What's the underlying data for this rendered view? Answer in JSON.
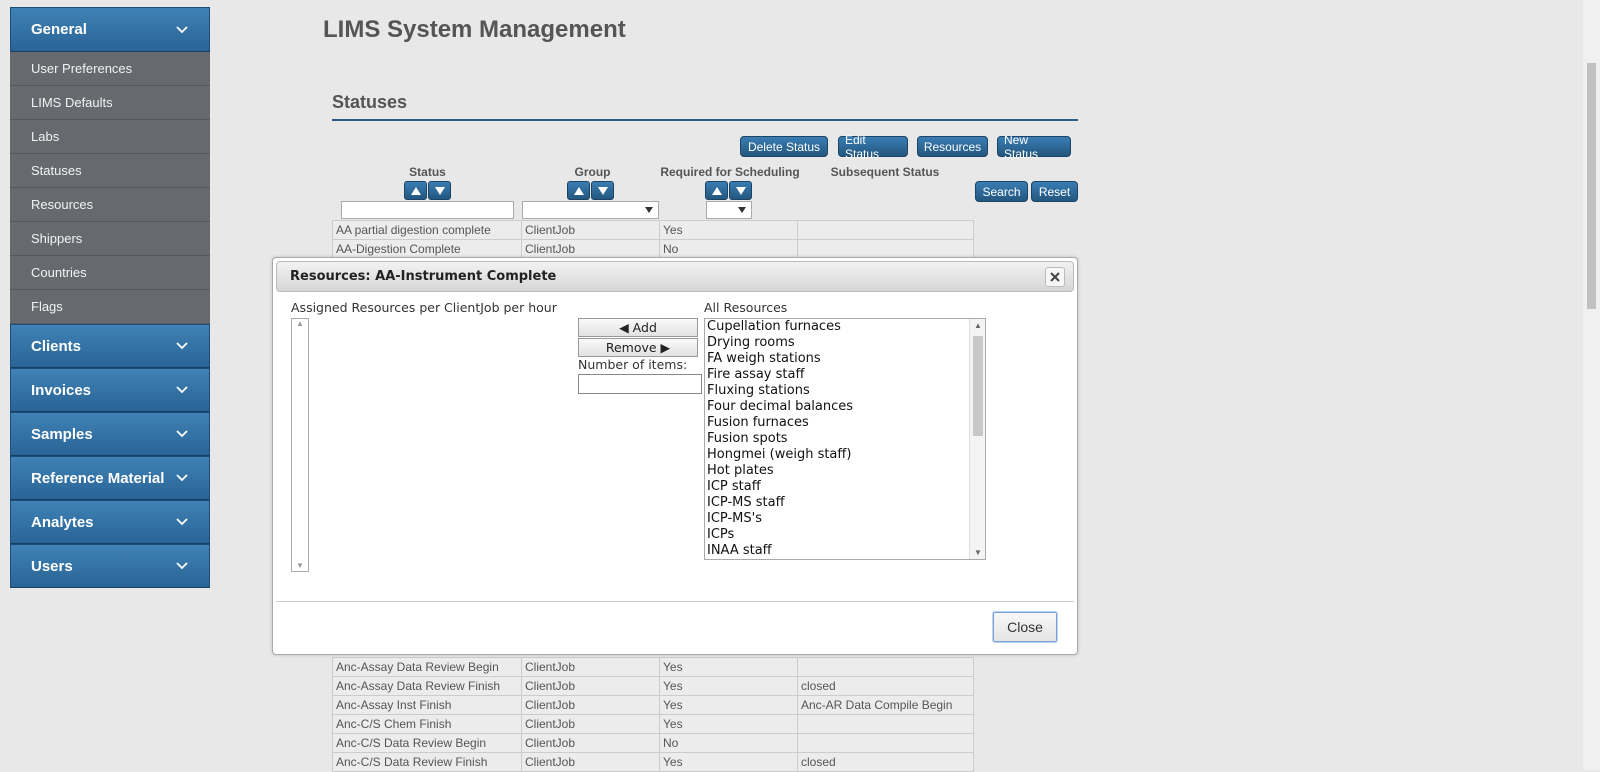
{
  "sidebar": {
    "general": {
      "label": "General",
      "items": [
        "User Preferences",
        "LIMS Defaults",
        "Labs",
        "Statuses",
        "Resources",
        "Shippers",
        "Countries",
        "Flags"
      ]
    },
    "sections": [
      "Clients",
      "Invoices",
      "Samples",
      "Reference Material",
      "Analytes",
      "Users"
    ]
  },
  "page": {
    "title": "LIMS System Management"
  },
  "statuses": {
    "title": "Statuses",
    "buttons": {
      "delete": "Delete Status",
      "edit": "Edit Status",
      "resources": "Resources",
      "new": "New Status",
      "search": "Search",
      "reset": "Reset"
    },
    "columns": {
      "status": "Status",
      "group": "Group",
      "required": "Required for Scheduling",
      "subsequent": "Subsequent Status"
    },
    "rows_top": [
      [
        "AA partial digestion complete",
        "ClientJob",
        "Yes",
        ""
      ],
      [
        "AA-Digestion Complete",
        "ClientJob",
        "No",
        ""
      ]
    ],
    "rows_bottom": [
      [
        "Anc-Assay Data Review Begin",
        "ClientJob",
        "Yes",
        ""
      ],
      [
        "Anc-Assay Data Review Finish",
        "ClientJob",
        "Yes",
        "closed"
      ],
      [
        "Anc-Assay Inst Finish",
        "ClientJob",
        "Yes",
        "Anc-AR Data Compile Begin"
      ],
      [
        "Anc-C/S Chem Finish",
        "ClientJob",
        "Yes",
        ""
      ],
      [
        "Anc-C/S Data Review Begin",
        "ClientJob",
        "No",
        ""
      ],
      [
        "Anc-C/S Data Review Finish",
        "ClientJob",
        "Yes",
        "closed"
      ]
    ]
  },
  "dialog": {
    "title": "Resources: AA-Instrument Complete",
    "assigned_label": "Assigned Resources per ClientJob per hour",
    "all_label": "All Resources",
    "add_label": "◀ Add",
    "remove_label": "Remove ▶",
    "num_items_label": "Number of items:",
    "close_label": "Close",
    "all_resources": [
      "Cupellation furnaces",
      "Drying rooms",
      "FA weigh stations",
      "Fire assay staff",
      "Fluxing stations",
      "Four decimal balances",
      "Fusion furnaces",
      "Fusion spots",
      "Hongmei (weigh staff)",
      "Hot plates",
      "ICP staff",
      "ICP-MS staff",
      "ICP-MS's",
      "ICPs",
      "INAA staff"
    ]
  }
}
